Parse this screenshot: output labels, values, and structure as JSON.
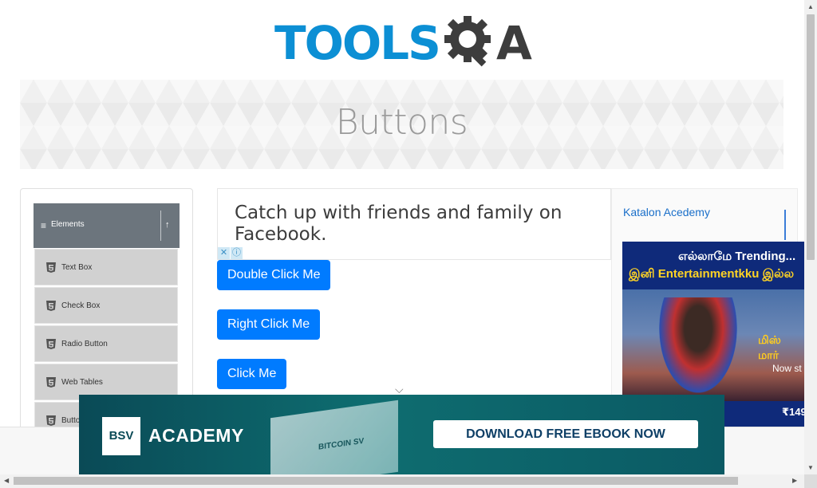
{
  "header": {
    "logo_text": "TOOLSQA",
    "logo_tools": "TOOLS",
    "logo_a": "A"
  },
  "banner": {
    "title": "Buttons"
  },
  "sidebar": {
    "group_label": "Elements",
    "items": [
      {
        "label": "Text Box"
      },
      {
        "label": "Check Box"
      },
      {
        "label": "Radio Button"
      },
      {
        "label": "Web Tables"
      },
      {
        "label": "Buttons"
      }
    ]
  },
  "main": {
    "ad_text": "Catch up with friends and family on Facebook.",
    "buttons": {
      "double_click": "Double Click Me",
      "right_click": "Right Click Me",
      "click": "Click Me"
    }
  },
  "right_ad": {
    "katalon_alt": "Katalon Acedemy",
    "tamil_line1": "எல்லாமே Trending...",
    "tamil_line2": "இனி Entertainmentkku இல்ல",
    "poster_title": "மிஸ் மார்",
    "now_text": "Now st",
    "price": "₹149"
  },
  "bottom_ad": {
    "logo": "BSV",
    "academy": "ACADEMY",
    "book_text": "BITCOIN SV",
    "cta": "DOWNLOAD FREE EBOOK NOW"
  },
  "colors": {
    "primary": "#007bff",
    "logo_blue": "#0c8fd4",
    "logo_dark": "#3d3d3d",
    "sidebar_header": "#6c757d"
  },
  "icons": [
    "menu-icon",
    "chevron-up-icon",
    "html5-icon",
    "adchoices-icon",
    "close-icon",
    "chevron-down-icon"
  ]
}
